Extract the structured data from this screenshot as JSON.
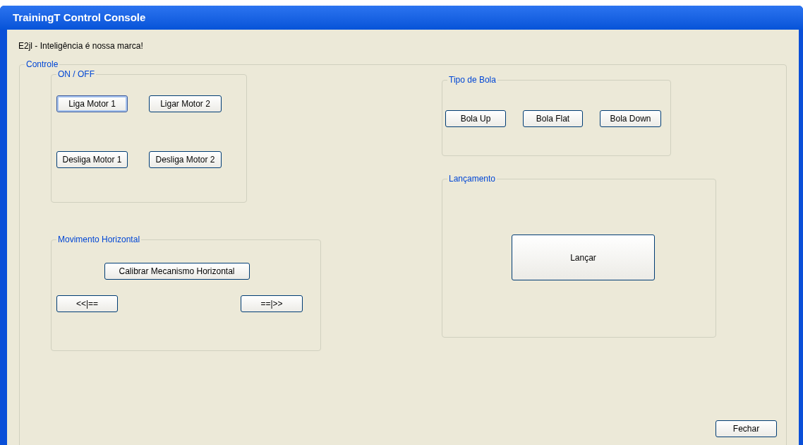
{
  "window": {
    "title": "TrainingT Control Console"
  },
  "tagline": "E2jl - Inteligência é nossa marca!",
  "controle": {
    "label": "Controle",
    "on_off": {
      "label": "ON / OFF",
      "buttons": [
        {
          "label": "Liga Motor 1",
          "focused": true
        },
        {
          "label": "Ligar Motor 2",
          "focused": false
        },
        {
          "label": "Desliga Motor 1",
          "focused": false
        },
        {
          "label": "Desliga Motor 2",
          "focused": false
        }
      ]
    },
    "movimento_horizontal": {
      "label": "Movimento Horizontal",
      "calibrate_button": "Calibrar Mecanismo Horizontal",
      "left_button": "<<|==",
      "right_button": "==|>>"
    },
    "tipo_de_bola": {
      "label": "Tipo de Bola",
      "buttons": [
        "Bola Up",
        "Bola Flat",
        "Bola Down"
      ]
    },
    "lancamento": {
      "label": "Lançamento",
      "button": "Lançar"
    },
    "close_button": "Fechar"
  }
}
